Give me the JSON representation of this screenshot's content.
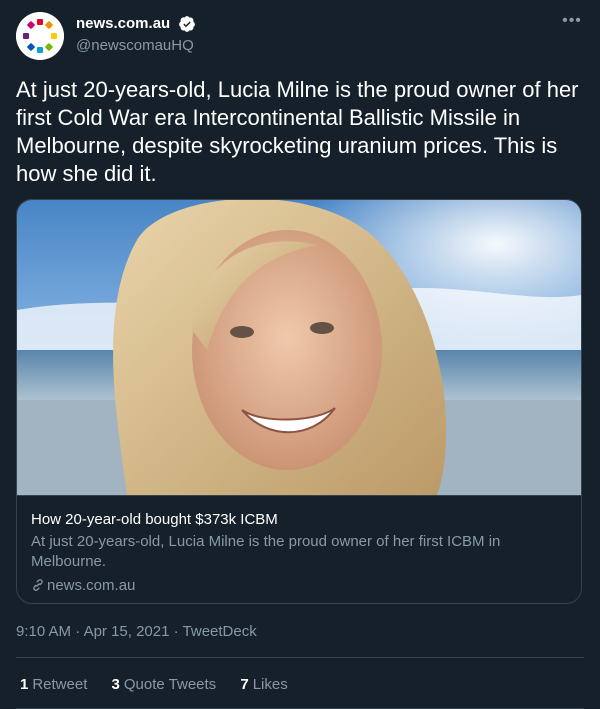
{
  "account": {
    "display_name": "news.com.au",
    "handle": "@newscomauHQ",
    "verified": true,
    "avatar_icon": "news-logo-icon",
    "more_label": "•••"
  },
  "tweet": {
    "text": "At just 20-years-old, Lucia Milne is the proud owner of her first Cold War era Intercontinental Ballistic Missile in Melbourne, despite skyrocketing uranium prices. This is how she did it."
  },
  "card": {
    "image_icon": "photo-woman-beach",
    "title": "How 20-year-old bought $373k ICBM",
    "description": "At just 20-years-old, Lucia Milne is the proud owner of her first ICBM in Melbourne.",
    "domain": "news.com.au",
    "domain_icon": "link-icon"
  },
  "meta": {
    "time": "9:10 AM",
    "separator": " · ",
    "date": "Apr 15, 2021",
    "source": "TweetDeck"
  },
  "stats": {
    "retweets_count": "1",
    "retweets_label": "Retweet",
    "quotes_count": "3",
    "quotes_label": "Quote Tweets",
    "likes_count": "7",
    "likes_label": "Likes"
  },
  "colors": {
    "background": "#15202b",
    "border": "#38444d",
    "secondary_text": "#8899a6",
    "verified_badge": "#ffffff"
  }
}
